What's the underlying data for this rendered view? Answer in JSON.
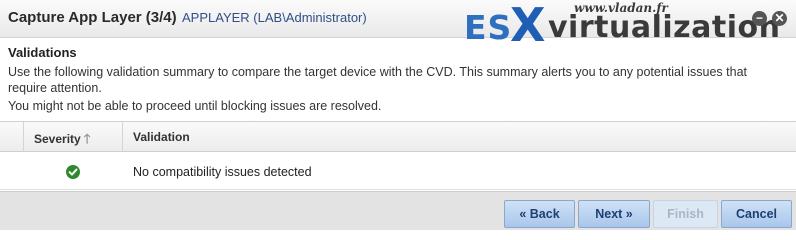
{
  "header": {
    "title": "Capture App Layer (3/4)",
    "subtitle": "APPLAYER (LAB\\Administrator)",
    "minimize_glyph": "−",
    "close_glyph": "✕"
  },
  "watermark": {
    "url": "www.vladan.fr",
    "brand_es": "ES",
    "brand_x": "X",
    "brand_rest": "virtualization"
  },
  "section": {
    "title": "Validations",
    "description": "Use the following validation summary to compare the target device with the CVD. This summary alerts you to any potential issues that require attention.",
    "note": "You might not be able to proceed until blocking issues are resolved."
  },
  "table": {
    "columns": [
      "Severity",
      "Validation"
    ],
    "sort_arrow": "🡑",
    "rows": [
      {
        "severity_icon": "check-circle-icon",
        "validation": "No compatibility issues detected"
      }
    ]
  },
  "footer": {
    "back_label": "« Back",
    "next_label": "Next »",
    "finish_label": "Finish",
    "cancel_label": "Cancel"
  },
  "colors": {
    "accent": "#2f4f86",
    "ok": "#2f8a2f",
    "button_bg": "#b9d2f0"
  }
}
